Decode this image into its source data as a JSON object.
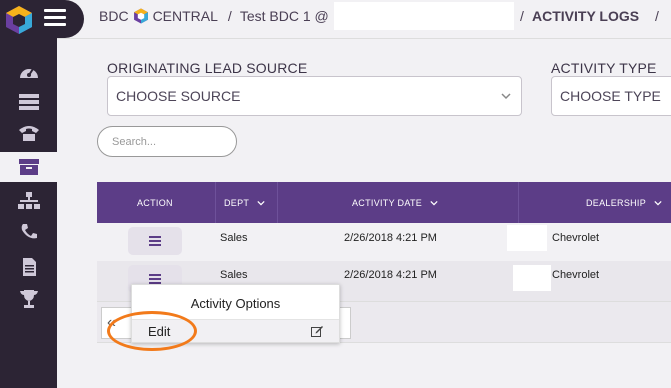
{
  "header": {
    "brand_left": "BDC",
    "brand_right": "CENTRAL",
    "crumb1": "Test BDC 1 @",
    "current": "ACTIVITY LOGS",
    "sep": "/"
  },
  "filters": {
    "lead_source_label": "ORIGINATING LEAD SOURCE",
    "lead_source_value": "CHOOSE SOURCE",
    "activity_type_label": "ACTIVITY TYPE",
    "activity_type_value": "CHOOSE TYPE"
  },
  "search": {
    "placeholder": "Search..."
  },
  "table": {
    "columns": [
      "ACTION",
      "DEPT",
      "ACTIVITY DATE",
      "DEALERSHIP"
    ],
    "rows": [
      {
        "dept": "Sales",
        "date": "2/26/2018 4:21 PM",
        "dealership": "Chevrolet"
      },
      {
        "dept": "Sales",
        "date": "2/26/2018 4:21 PM",
        "dealership": "Chevrolet"
      }
    ]
  },
  "popup": {
    "title": "Activity Options",
    "edit_label": "Edit"
  },
  "pager": {
    "prev": "«"
  },
  "colors": {
    "sidebar": "#2c2434",
    "header_purple": "#5c3d87",
    "highlight": "#f27a1a"
  },
  "sidebar_icons": [
    "dashboard-icon",
    "list-icon",
    "phone-icon",
    "archive-icon",
    "org-chart-icon",
    "phone-handset-icon",
    "document-icon",
    "trophy-icon"
  ]
}
